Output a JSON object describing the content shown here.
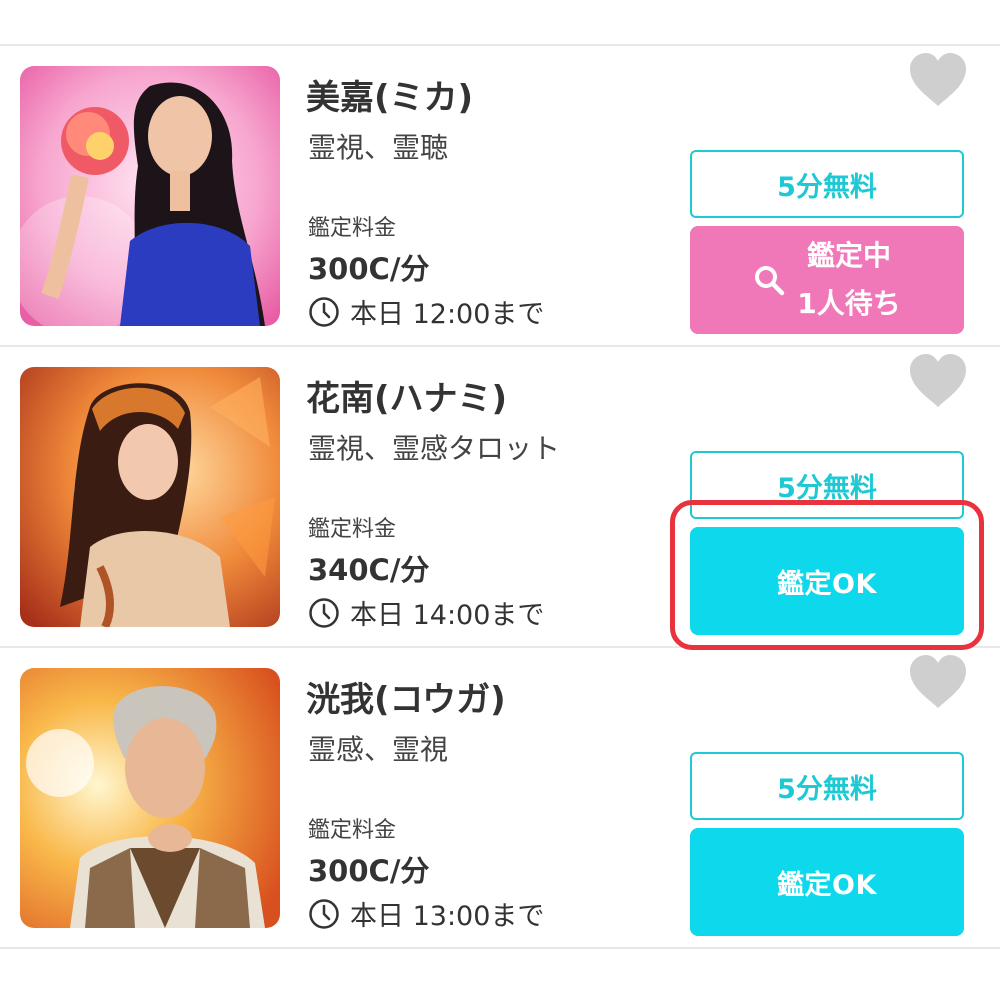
{
  "fortune_tellers": [
    {
      "name": "美嘉(ミカ)",
      "genres": "霊視、霊聴",
      "fee_label": "鑑定料金",
      "fee": "300C/分",
      "hours": "本日 12:00まで",
      "free_badge": "5分無料",
      "status": "busy",
      "status_label": "鑑定中",
      "queue_label": "1人待ち"
    },
    {
      "name": "花南(ハナミ)",
      "genres": "霊視、霊感タロット",
      "fee_label": "鑑定料金",
      "fee": "340C/分",
      "hours": "本日 14:00まで",
      "free_badge": "5分無料",
      "status": "available",
      "status_label": "鑑定OK"
    },
    {
      "name": "洸我(コウガ)",
      "genres": "霊感、霊視",
      "fee_label": "鑑定料金",
      "fee": "300C/分",
      "hours": "本日 13:00まで",
      "free_badge": "5分無料",
      "status": "available",
      "status_label": "鑑定OK"
    }
  ],
  "colors": {
    "accent_cyan": "#0ed8eb",
    "badge_border": "#1ec9d4",
    "busy_pink": "#f078b8",
    "highlight_red": "#e8333e",
    "favorite_gray": "#cfcfcf"
  },
  "icons": {
    "favorite": "heart-icon",
    "hours": "clock-icon",
    "busy": "search-icon"
  }
}
